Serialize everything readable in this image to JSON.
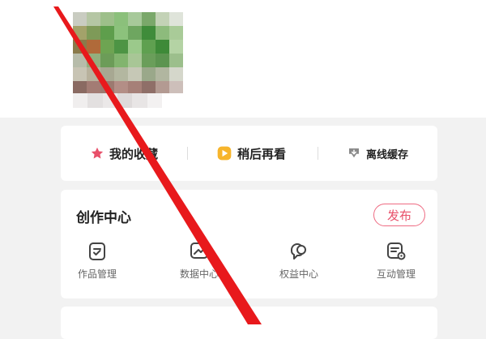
{
  "profile": {
    "avatar_icon": "pixelated-avatar"
  },
  "quick_actions": {
    "favorites": {
      "label": "我的收藏",
      "icon": "star-icon",
      "color": "#e8506a"
    },
    "watch_later": {
      "label": "稍后再看",
      "icon": "play-later-icon",
      "color": "#f7b52c"
    },
    "offline_cache": {
      "label": "离线缓存",
      "icon": "download-icon",
      "color": "#8a8a8a"
    }
  },
  "creation_center": {
    "title": "创作中心",
    "publish_label": "发布",
    "accent": "#e8506a",
    "tools": [
      {
        "label": "作品管理",
        "icon": "works-manage-icon"
      },
      {
        "label": "数据中心",
        "icon": "data-center-icon"
      },
      {
        "label": "权益中心",
        "icon": "benefits-center-icon"
      },
      {
        "label": "互动管理",
        "icon": "interaction-manage-icon"
      }
    ]
  },
  "annotation": {
    "color": "#e8191c",
    "icon": "red-arrow-annotation"
  }
}
